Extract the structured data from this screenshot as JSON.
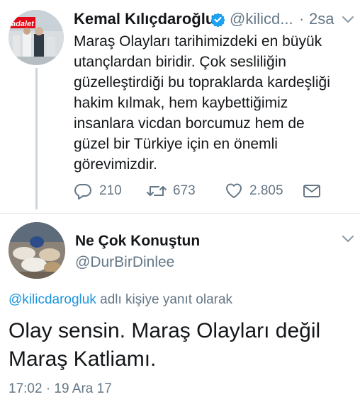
{
  "tweet": {
    "author_name": "Kemal Kılıçdaroğlu",
    "author_handle": "@kilicd...",
    "dot": "·",
    "timestamp": "2sa",
    "avatar_text": "adalet",
    "verified_color": "#1da1f2",
    "text_lines": [
      "Maraş Olayları tarihimizdeki en büyük",
      "utançlardan biridir. Çok sesliliğin",
      "güzelleştirdiği bu topraklarda kardeşliği",
      "hakim kılmak, hem kaybettiğimiz",
      "insanlara vicdan borcumuz hem de",
      "güzel bir Türkiye için en önemli",
      "görevimizdir."
    ],
    "actions": {
      "reply_count": "210",
      "retweet_count": "673",
      "like_count": "2.805",
      "reply_icon": "reply-icon",
      "retweet_icon": "retweet-icon",
      "like_icon": "heart-icon",
      "message_icon": "envelope-icon"
    }
  },
  "reply": {
    "author_name": "Ne Çok Konuştun",
    "author_handle": "@DurBirDinlee",
    "replying_to_mention": "@kilicdarogluk",
    "replying_to_suffix": " adlı kişiye yanıt olarak",
    "text_lines": [
      "Olay sensin. Maraş Olayları değil",
      "Maraş Katliamı."
    ],
    "timestamp": "17:02 · 19 Ara 17"
  },
  "colors": {
    "text": "#14171a",
    "secondary": "#657786",
    "link": "#1b95e0",
    "thread_line": "#cdd4da"
  }
}
